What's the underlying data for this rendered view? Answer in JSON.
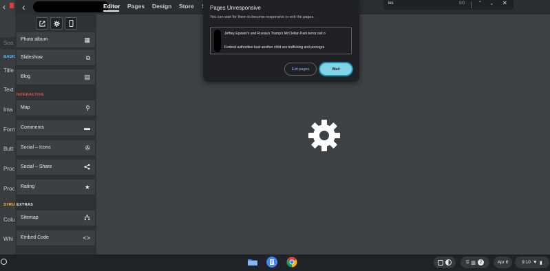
{
  "topbar": {
    "tabs": [
      {
        "label": "Editor",
        "active": true
      },
      {
        "label": "Pages"
      },
      {
        "label": "Design"
      },
      {
        "label": "Store"
      },
      {
        "label": "S"
      }
    ]
  },
  "left_strip": {
    "search_placeholder": "Sea",
    "items": [
      {
        "label": "BASIC",
        "color": "#4fc3f7",
        "head": true
      },
      {
        "label": "Title"
      },
      {
        "label": "Text"
      },
      {
        "label": "Ima"
      },
      {
        "label": "Form"
      },
      {
        "label": "Butt"
      },
      {
        "label": "Proc"
      },
      {
        "label": "Proc"
      },
      {
        "label": "STRUC",
        "color": "#fbc02d",
        "head": true
      },
      {
        "label": "Colu"
      },
      {
        "label": "Whi"
      }
    ]
  },
  "panel": {
    "items_top": [
      {
        "label": "Photo album",
        "icon": "grid-icon"
      },
      {
        "label": "Slideshow",
        "icon": "slideshow-icon"
      },
      {
        "label": "Blog",
        "icon": "blog-icon"
      }
    ],
    "interactive_heading": "INTERACTIVE",
    "interactive_color": "#e5534b",
    "items_interactive": [
      {
        "label": "Map",
        "icon": "map-pin-icon"
      },
      {
        "label": "Comments",
        "icon": "comment-icon"
      },
      {
        "label": "Social – Icons",
        "icon": "social-icons-icon"
      },
      {
        "label": "Social – Share",
        "icon": "share-icon"
      },
      {
        "label": "Rating",
        "icon": "star-icon"
      }
    ],
    "extras_heading": "EXTRAS",
    "items_extras": [
      {
        "label": "Sitemap",
        "icon": "sitemap-icon"
      },
      {
        "label": "Embed Code",
        "icon": "code-icon"
      }
    ]
  },
  "dialog": {
    "title": "Pages Unresponsive",
    "body": "You can wait for them to become responsive or exit the pages.",
    "pages": [
      "Jeffrey Epstein's and Russia's Trump's McClellan Park terror cell o",
      "Federal authorities bust another child sex trafficking and pornogra"
    ],
    "exit_label": "Exit pages",
    "wait_label": "Wait"
  },
  "findbar": {
    "query": "ies",
    "count": "0/0"
  },
  "shelf": {
    "badge_count": "2",
    "date": "Apr 6",
    "time": "9:10"
  }
}
